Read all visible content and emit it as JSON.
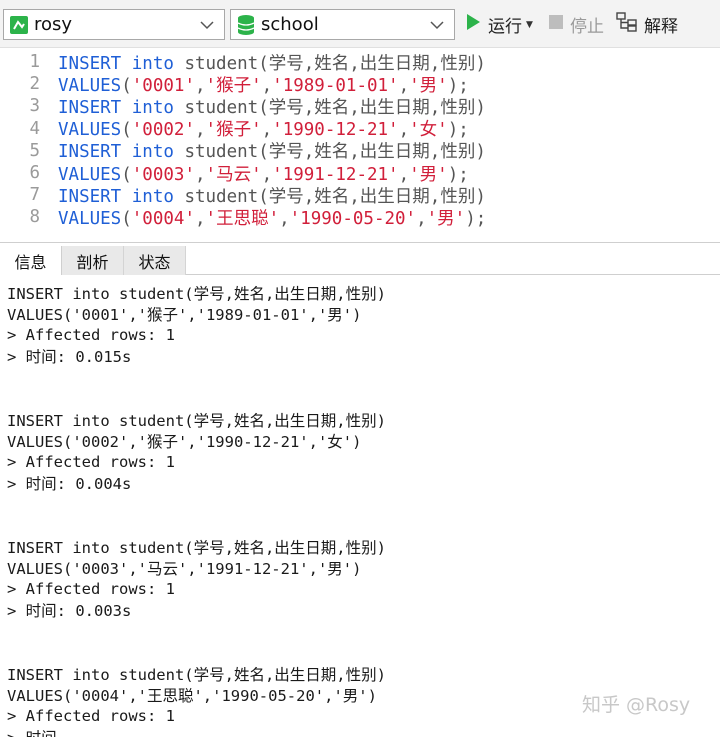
{
  "toolbar": {
    "connection": "rosy",
    "database": "school",
    "run_label": "运行",
    "stop_label": "停止",
    "explain_label": "解释"
  },
  "editor": {
    "lines": [
      {
        "num": "1",
        "parts": [
          {
            "t": "kw",
            "v": "INSERT into"
          },
          {
            "t": "tx",
            "v": " student(学号,姓名,出生日期,性别)"
          }
        ]
      },
      {
        "num": "2",
        "parts": [
          {
            "t": "kw",
            "v": "VALUES"
          },
          {
            "t": "pn",
            "v": "("
          },
          {
            "t": "str",
            "v": "'0001'"
          },
          {
            "t": "pn",
            "v": ","
          },
          {
            "t": "str",
            "v": "'猴子'"
          },
          {
            "t": "pn",
            "v": ","
          },
          {
            "t": "str",
            "v": "'1989-01-01'"
          },
          {
            "t": "pn",
            "v": ","
          },
          {
            "t": "str",
            "v": "'男'"
          },
          {
            "t": "pn",
            "v": ");"
          }
        ]
      },
      {
        "num": "3",
        "parts": [
          {
            "t": "kw",
            "v": "INSERT into"
          },
          {
            "t": "tx",
            "v": " student(学号,姓名,出生日期,性别)"
          }
        ]
      },
      {
        "num": "4",
        "parts": [
          {
            "t": "kw",
            "v": "VALUES"
          },
          {
            "t": "pn",
            "v": "("
          },
          {
            "t": "str",
            "v": "'0002'"
          },
          {
            "t": "pn",
            "v": ","
          },
          {
            "t": "str",
            "v": "'猴子'"
          },
          {
            "t": "pn",
            "v": ","
          },
          {
            "t": "str",
            "v": "'1990-12-21'"
          },
          {
            "t": "pn",
            "v": ","
          },
          {
            "t": "str",
            "v": "'女'"
          },
          {
            "t": "pn",
            "v": ");"
          }
        ]
      },
      {
        "num": "5",
        "parts": [
          {
            "t": "kw",
            "v": "INSERT into"
          },
          {
            "t": "tx",
            "v": " student(学号,姓名,出生日期,性别)"
          }
        ]
      },
      {
        "num": "6",
        "parts": [
          {
            "t": "kw",
            "v": "VALUES"
          },
          {
            "t": "pn",
            "v": "("
          },
          {
            "t": "str",
            "v": "'0003'"
          },
          {
            "t": "pn",
            "v": ","
          },
          {
            "t": "str",
            "v": "'马云'"
          },
          {
            "t": "pn",
            "v": ","
          },
          {
            "t": "str",
            "v": "'1991-12-21'"
          },
          {
            "t": "pn",
            "v": ","
          },
          {
            "t": "str",
            "v": "'男'"
          },
          {
            "t": "pn",
            "v": ");"
          }
        ]
      },
      {
        "num": "7",
        "parts": [
          {
            "t": "kw",
            "v": "INSERT into"
          },
          {
            "t": "tx",
            "v": " student(学号,姓名,出生日期,性别)"
          }
        ]
      },
      {
        "num": "8",
        "parts": [
          {
            "t": "kw",
            "v": "VALUES"
          },
          {
            "t": "pn",
            "v": "("
          },
          {
            "t": "str",
            "v": "'0004'"
          },
          {
            "t": "pn",
            "v": ","
          },
          {
            "t": "str",
            "v": "'王思聪'"
          },
          {
            "t": "pn",
            "v": ","
          },
          {
            "t": "str",
            "v": "'1990-05-20'"
          },
          {
            "t": "pn",
            "v": ","
          },
          {
            "t": "str",
            "v": "'男'"
          },
          {
            "t": "pn",
            "v": ");"
          }
        ]
      }
    ]
  },
  "tabs": {
    "info": "信息",
    "profile": "剖析",
    "status": "状态"
  },
  "messages": [
    {
      "sql": "INSERT into student(学号,姓名,出生日期,性别)",
      "values": "VALUES('0001','猴子','1989-01-01','男')",
      "affected": "> Affected rows: 1",
      "time": "> 时间: 0.015s"
    },
    {
      "sql": "INSERT into student(学号,姓名,出生日期,性别)",
      "values": "VALUES('0002','猴子','1990-12-21','女')",
      "affected": "> Affected rows: 1",
      "time": "> 时间: 0.004s"
    },
    {
      "sql": "INSERT into student(学号,姓名,出生日期,性别)",
      "values": "VALUES('0003','马云','1991-12-21','男')",
      "affected": "> Affected rows: 1",
      "time": "> 时间: 0.003s"
    },
    {
      "sql": "INSERT into student(学号,姓名,出生日期,性别)",
      "values": "VALUES('0004','王思聪','1990-05-20','男')",
      "affected": "> Affected rows: 1",
      "time": "> 时间"
    }
  ],
  "watermark": "知乎 @Rosy",
  "colors": {
    "keyword": "#1f5fd6",
    "string": "#d11f3a",
    "run_icon": "#2cb34a",
    "db_icon": "#2cb34a"
  },
  "icons": {
    "connection": "connection-icon",
    "database": "database-icon",
    "run": "play-icon",
    "stop": "stop-icon",
    "explain": "explain-icon",
    "dropdown": "chevron-down-icon"
  }
}
